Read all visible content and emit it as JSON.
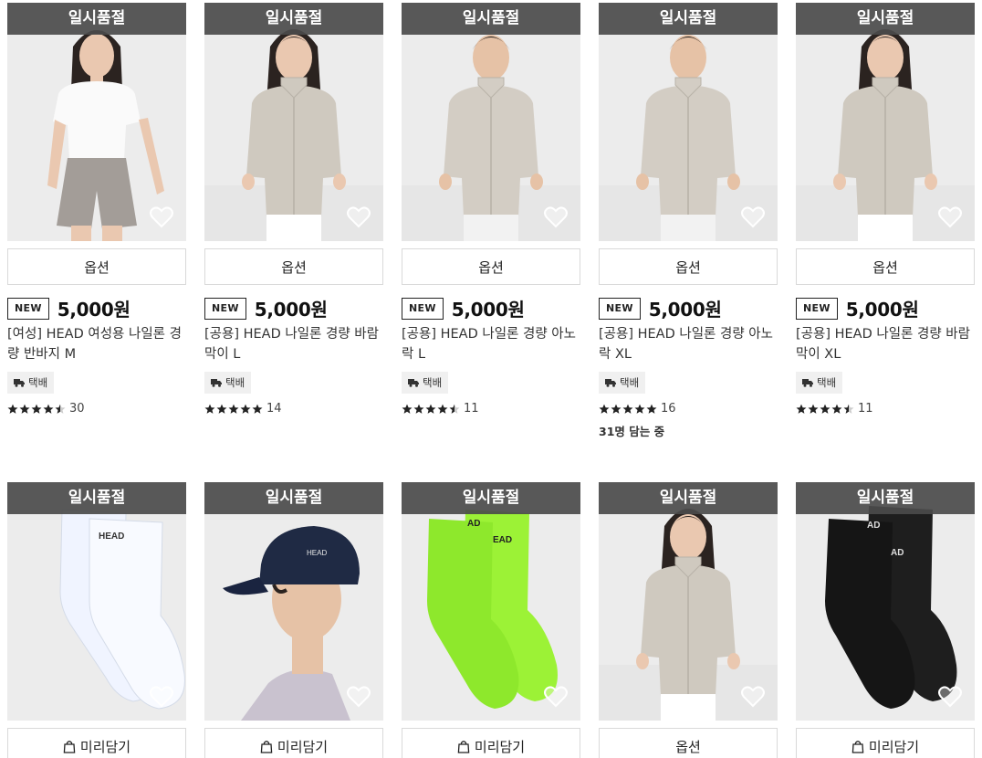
{
  "colors": {
    "soldout_bg": "#4b4b4b",
    "star": "#222222",
    "heart": "#ffffff"
  },
  "products": [
    {
      "soldout": "일시품절",
      "image": "woman-white-tee-gray-shorts",
      "button": "옵션",
      "button_icon": null,
      "badge": "NEW",
      "price": "5,000원",
      "title": "[여성] HEAD 여성용 나일론 경량 반바지 M",
      "shipping": "택배",
      "rating": 4.5,
      "reviews": "30",
      "watching": null
    },
    {
      "soldout": "일시품절",
      "image": "woman-beige-windbreaker",
      "button": "옵션",
      "button_icon": null,
      "badge": "NEW",
      "price": "5,000원",
      "title": "[공용] HEAD 나일론 경량 바람막이 L",
      "shipping": "택배",
      "rating": 5,
      "reviews": "14",
      "watching": null
    },
    {
      "soldout": "일시품절",
      "image": "man-beige-anorak",
      "button": "옵션",
      "button_icon": null,
      "badge": "NEW",
      "price": "5,000원",
      "title": "[공용] HEAD 나일론 경량 아노락 L",
      "shipping": "택배",
      "rating": 4.5,
      "reviews": "11",
      "watching": null
    },
    {
      "soldout": "일시품절",
      "image": "man-beige-anorak",
      "button": "옵션",
      "button_icon": null,
      "badge": "NEW",
      "price": "5,000원",
      "title": "[공용] HEAD 나일론 경량 아노락 XL",
      "shipping": "택배",
      "rating": 5,
      "reviews": "16",
      "watching": "31명 담는 중"
    },
    {
      "soldout": "일시품절",
      "image": "woman-beige-windbreaker",
      "button": "옵션",
      "button_icon": null,
      "badge": "NEW",
      "price": "5,000원",
      "title": "[공용] HEAD 나일론 경량 바람막이 XL",
      "shipping": "택배",
      "rating": 4.5,
      "reviews": "11",
      "watching": null
    },
    {
      "soldout": "일시품절",
      "image": "white-socks",
      "button": "미리담기",
      "button_icon": "bag-icon"
    },
    {
      "soldout": "일시품절",
      "image": "man-navy-cap",
      "button": "미리담기",
      "button_icon": "bag-icon"
    },
    {
      "soldout": "일시품절",
      "image": "green-socks",
      "button": "미리담기",
      "button_icon": "bag-icon"
    },
    {
      "soldout": "일시품절",
      "image": "woman-beige-windbreaker",
      "button": "옵션",
      "button_icon": null
    },
    {
      "soldout": "일시품절",
      "image": "black-socks",
      "button": "미리담기",
      "button_icon": "bag-icon"
    }
  ]
}
